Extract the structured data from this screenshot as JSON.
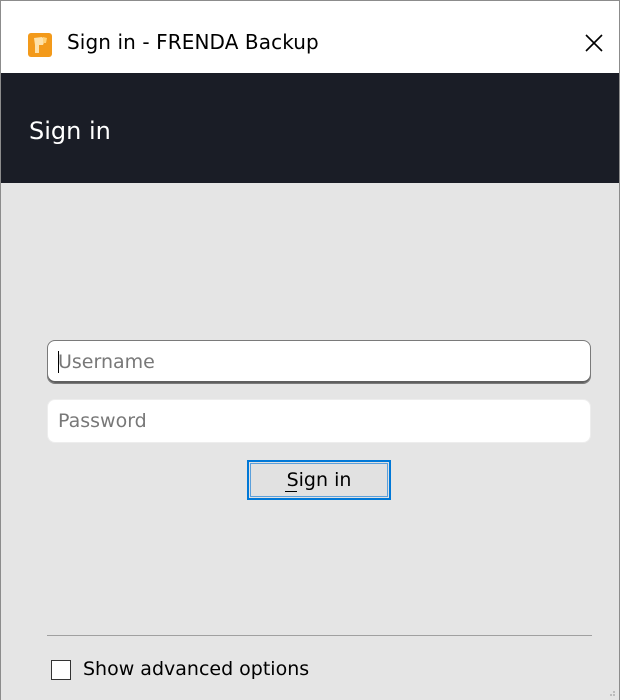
{
  "window": {
    "title": "Sign in - FRENDA Backup"
  },
  "header": {
    "title": "Sign in"
  },
  "form": {
    "username_placeholder": "Username",
    "username_value": "",
    "password_placeholder": "Password",
    "password_value": "",
    "signin_label": "Sign in"
  },
  "footer": {
    "advanced_options_label": "Show advanced options",
    "advanced_options_checked": false
  },
  "icons": {
    "app": "frenda-app-icon",
    "close": "close-icon"
  },
  "colors": {
    "header_bg": "#1a1d26",
    "accent": "#0078d7",
    "app_icon": "#f39a1a",
    "body_bg": "#e5e5e5"
  }
}
